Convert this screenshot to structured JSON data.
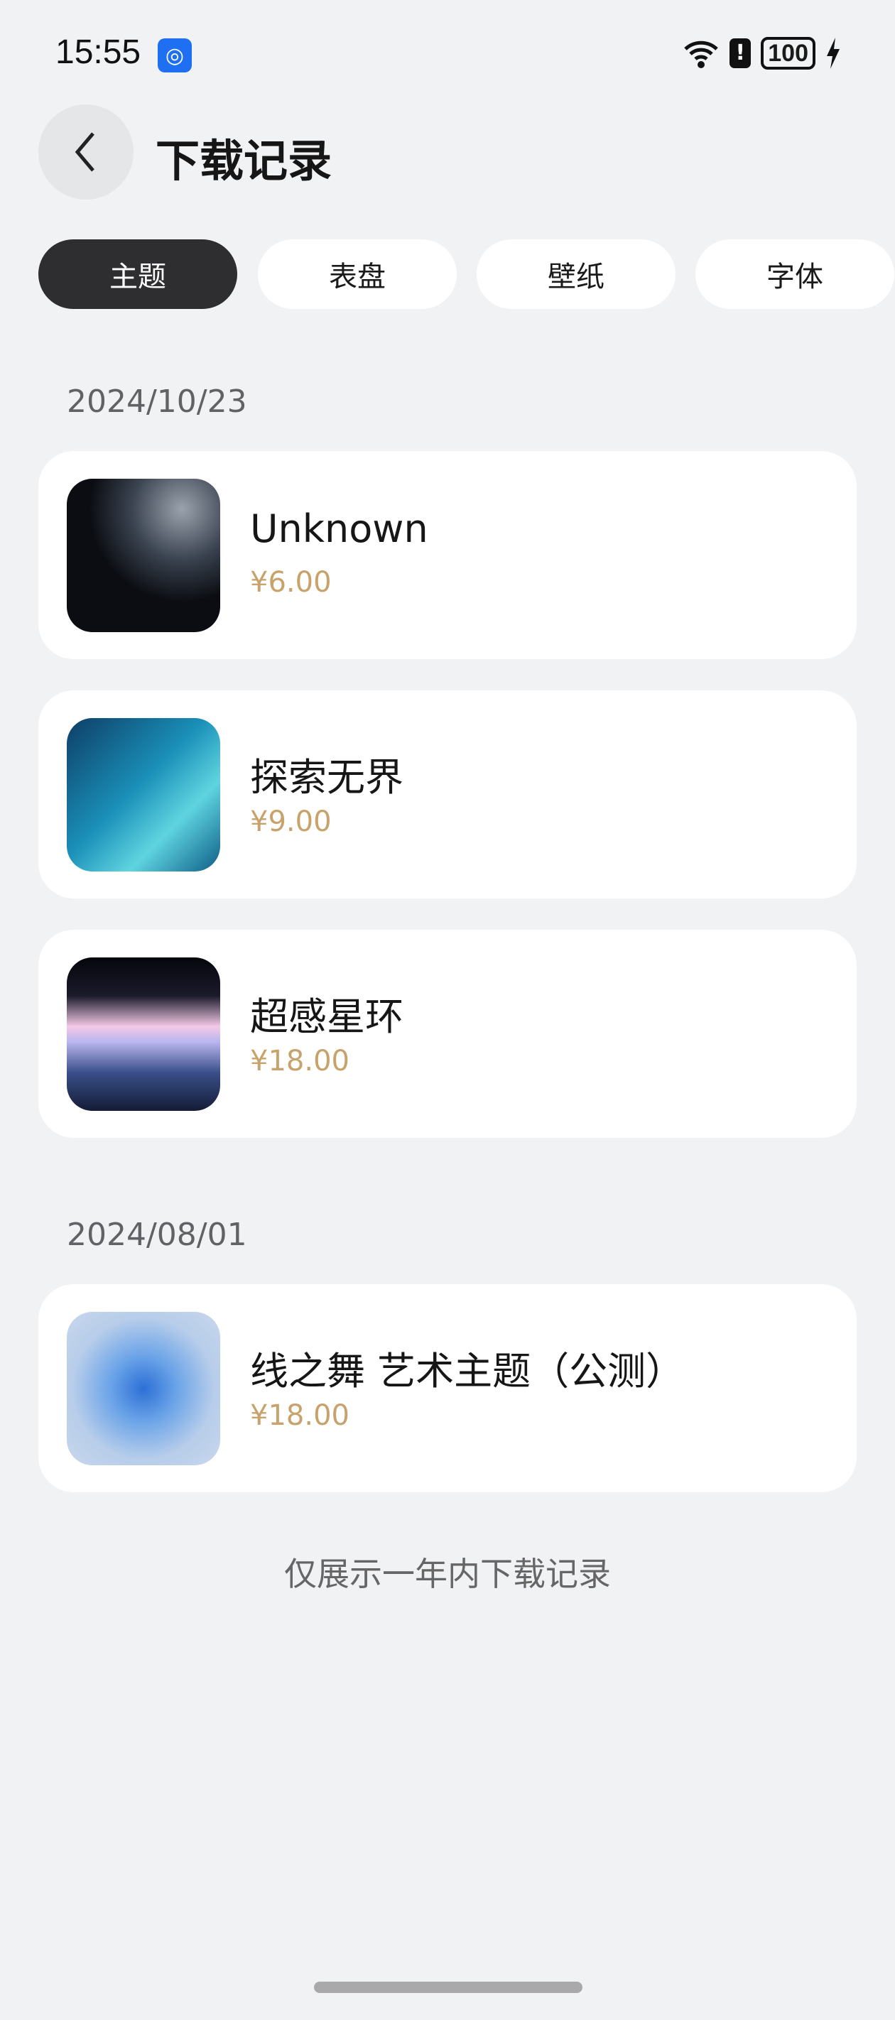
{
  "status_bar": {
    "time": "15:55",
    "battery": "100"
  },
  "header": {
    "title": "下载记录"
  },
  "tabs": [
    {
      "label": "主题",
      "active": true
    },
    {
      "label": "表盘"
    },
    {
      "label": "壁纸"
    },
    {
      "label": "字体"
    }
  ],
  "groups": [
    {
      "date": "2024/10/23",
      "items": [
        {
          "name": "Unknown",
          "price": "¥6.00"
        },
        {
          "name": "探索无界",
          "price": "¥9.00"
        },
        {
          "name": "超感星环",
          "price": "¥18.00"
        }
      ]
    },
    {
      "date": "2024/08/01",
      "items": [
        {
          "name": "线之舞 艺术主题（公测）",
          "price": "¥18.00"
        }
      ]
    }
  ],
  "footer": "仅展示一年内下载记录",
  "colors": {
    "price": "#c8a26b",
    "active_tab": "#2e2e30",
    "background": "#f1f2f4"
  }
}
